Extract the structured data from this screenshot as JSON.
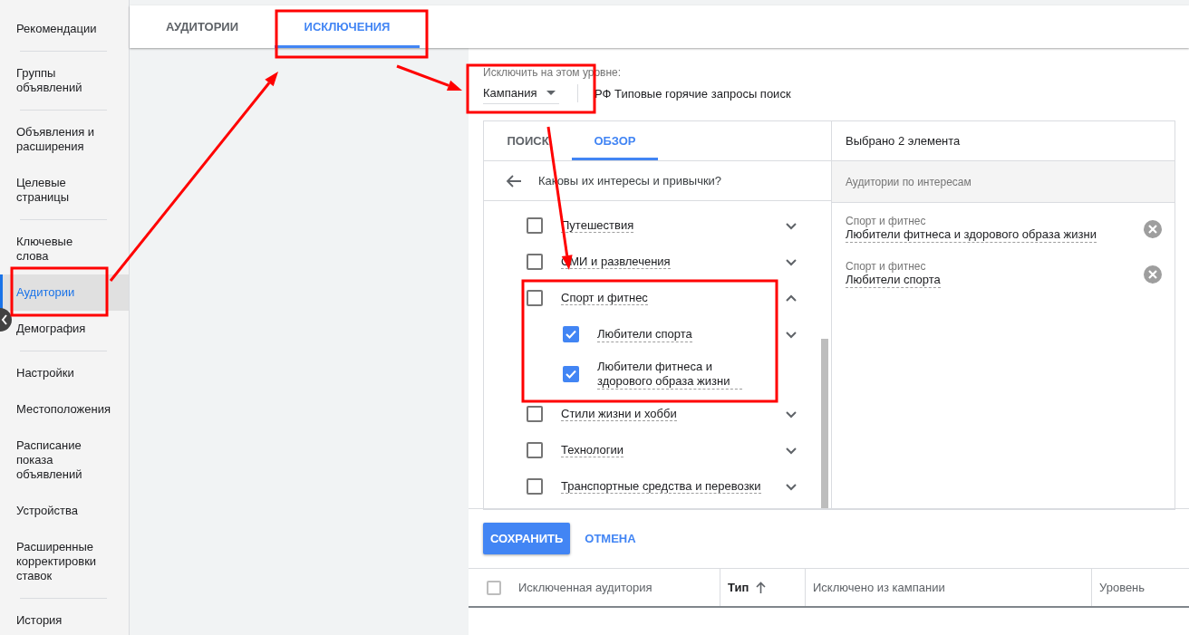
{
  "sidebar": {
    "groups": [
      [
        {
          "label": "Рекомендации",
          "selected": false
        }
      ],
      [
        {
          "label": "Группы\nобъявлений",
          "selected": false
        }
      ],
      [
        {
          "label": "Объявления и\nрасширения",
          "selected": false
        },
        {
          "label": "Целевые\nстраницы",
          "selected": false
        }
      ],
      [
        {
          "label": "Ключевые\nслова",
          "selected": false
        },
        {
          "label": "Аудитории",
          "selected": true
        },
        {
          "label": "Демография",
          "selected": false
        }
      ],
      [
        {
          "label": "Настройки",
          "selected": false
        },
        {
          "label": "Местоположения",
          "selected": false
        },
        {
          "label": "Расписание\nпоказа\nобъявлений",
          "selected": false
        },
        {
          "label": "Устройства",
          "selected": false
        },
        {
          "label": "Расширенные\nкорректировки\nставок",
          "selected": false
        }
      ],
      [
        {
          "label": "История",
          "selected": false
        }
      ]
    ]
  },
  "tabs": [
    {
      "label": "АУДИТОРИИ",
      "selected": false
    },
    {
      "label": "ИСКЛЮЧЕНИЯ",
      "selected": true
    }
  ],
  "level_picker": {
    "label": "Исключить на этом уровне:",
    "value": "Кампания",
    "campaign": "РФ Типовые горячие запросы поиск"
  },
  "browser": {
    "tabs": [
      {
        "label": "ПОИСК",
        "selected": false
      },
      {
        "label": "ОБЗОР",
        "selected": true
      }
    ],
    "back_title": "Каковы их интересы и привычки?",
    "items": [
      {
        "label": "Путешествия",
        "checked": false,
        "expanded": false
      },
      {
        "label": "СМИ и развлечения",
        "checked": false,
        "expanded": false
      },
      {
        "label": "Спорт и фитнес",
        "checked": false,
        "expanded": true,
        "children": [
          {
            "label": "Любители спорта",
            "checked": true,
            "expanded": false
          },
          {
            "label": "Любители фитнеса и здорового образа жизни",
            "checked": true
          }
        ]
      },
      {
        "label": "Стили жизни и хобби",
        "checked": false,
        "expanded": false
      },
      {
        "label": "Технологии",
        "checked": false,
        "expanded": false
      },
      {
        "label": "Транспортные средства и перевозки",
        "checked": false,
        "expanded": false
      }
    ]
  },
  "selection": {
    "title": "Выбрано 2 элемента",
    "group": "Аудитории по интересам",
    "items": [
      {
        "category": "Спорт и фитнес",
        "label": "Любители фитнеса и здорового образа жизни"
      },
      {
        "category": "Спорт и фитнес",
        "label": "Любители спорта"
      }
    ]
  },
  "actions": {
    "save": "СОХРАНИТЬ",
    "cancel": "ОТМЕНА"
  },
  "table": {
    "select_all_checked": false,
    "columns": [
      {
        "label": "Исключенная аудитория",
        "sorted": false
      },
      {
        "label": "Тип",
        "sorted": true
      },
      {
        "label": "Исключено из кампании",
        "sorted": false
      },
      {
        "label": "Уровень",
        "sorted": false
      }
    ]
  },
  "annotations": [
    {
      "kind": "box"
    },
    {
      "kind": "box"
    },
    {
      "kind": "box"
    },
    {
      "kind": "box"
    },
    {
      "kind": "arrow"
    },
    {
      "kind": "arrow"
    },
    {
      "kind": "arrow"
    }
  ]
}
